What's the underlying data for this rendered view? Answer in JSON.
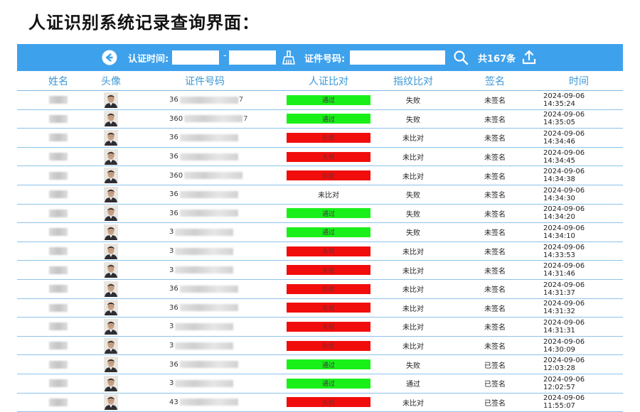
{
  "page": {
    "title": "人证识别系统记录查询界面："
  },
  "toolbar": {
    "cert_time_label": "认证时间:",
    "time_from_value": "",
    "time_to_value": "",
    "separator": "-",
    "id_label": "证件号码:",
    "id_value": "",
    "total_text": "共167条",
    "colors": {
      "bar": "#3ea1ec"
    },
    "icons": [
      "back-icon",
      "clear-broom-icon",
      "search-icon",
      "upload-icon"
    ]
  },
  "table": {
    "headers": {
      "name": "姓名",
      "avatar": "头像",
      "id": "证件号码",
      "face": "人证比对",
      "finger": "指纹比对",
      "sign": "签名",
      "time": "时间"
    },
    "status_colors": {
      "pass": "#19f019",
      "fail": "#f20d0d"
    },
    "rows": [
      {
        "id_prefix": "36",
        "id_tail": "7",
        "face": "通过",
        "face_status": "pass",
        "finger": "失败",
        "sign": "未签名",
        "time": "2024-09-06 14:35:24"
      },
      {
        "id_prefix": "360",
        "id_tail": "7",
        "face": "通过",
        "face_status": "pass",
        "finger": "失败",
        "sign": "未签名",
        "time": "2024-09-06 14:35:05"
      },
      {
        "id_prefix": "36",
        "id_tail": "",
        "face": "失败",
        "face_status": "fail",
        "finger": "未比对",
        "sign": "未签名",
        "time": "2024-09-06 14:34:46"
      },
      {
        "id_prefix": "36",
        "id_tail": "",
        "face": "失败",
        "face_status": "fail",
        "finger": "未比对",
        "sign": "未签名",
        "time": "2024-09-06 14:34:45"
      },
      {
        "id_prefix": "360",
        "id_tail": "",
        "face": "失败",
        "face_status": "fail",
        "finger": "未比对",
        "sign": "未签名",
        "time": "2024-09-06 14:34:38"
      },
      {
        "id_prefix": "36",
        "id_tail": "",
        "face": "未比对",
        "face_status": "none",
        "finger": "失败",
        "sign": "未签名",
        "time": "2024-09-06 14:34:30"
      },
      {
        "id_prefix": "36",
        "id_tail": "",
        "face": "通过",
        "face_status": "pass",
        "finger": "失败",
        "sign": "未签名",
        "time": "2024-09-06 14:34:20"
      },
      {
        "id_prefix": "3",
        "id_tail": "",
        "face": "通过",
        "face_status": "pass",
        "finger": "失败",
        "sign": "未签名",
        "time": "2024-09-06 14:34:10"
      },
      {
        "id_prefix": "3",
        "id_tail": "",
        "face": "失败",
        "face_status": "fail",
        "finger": "未比对",
        "sign": "未签名",
        "time": "2024-09-06 14:33:53"
      },
      {
        "id_prefix": "3",
        "id_tail": "",
        "face": "失败",
        "face_status": "fail",
        "finger": "未比对",
        "sign": "未签名",
        "time": "2024-09-06 14:31:46"
      },
      {
        "id_prefix": "36",
        "id_tail": "",
        "face": "失败",
        "face_status": "fail",
        "finger": "未比对",
        "sign": "未签名",
        "time": "2024-09-06 14:31:37"
      },
      {
        "id_prefix": "36",
        "id_tail": "",
        "face": "失败",
        "face_status": "fail",
        "finger": "未比对",
        "sign": "未签名",
        "time": "2024-09-06 14:31:32"
      },
      {
        "id_prefix": "3",
        "id_tail": "",
        "face": "失败",
        "face_status": "fail",
        "finger": "未比对",
        "sign": "未签名",
        "time": "2024-09-06 14:31:31"
      },
      {
        "id_prefix": "3",
        "id_tail": "",
        "face": "失败",
        "face_status": "fail",
        "finger": "未比对",
        "sign": "未签名",
        "time": "2024-09-06 14:30:09"
      },
      {
        "id_prefix": "36",
        "id_tail": "",
        "face": "通过",
        "face_status": "pass",
        "finger": "失败",
        "sign": "已签名",
        "time": "2024-09-06 12:03:28"
      },
      {
        "id_prefix": "3",
        "id_tail": "",
        "face": "通过",
        "face_status": "pass",
        "finger": "通过",
        "sign": "已签名",
        "time": "2024-09-06 12:02:57"
      },
      {
        "id_prefix": "43",
        "id_tail": "",
        "face": "失败",
        "face_status": "fail",
        "finger": "未比对",
        "sign": "已签名",
        "time": "2024-09-06 11:55:07"
      }
    ]
  }
}
